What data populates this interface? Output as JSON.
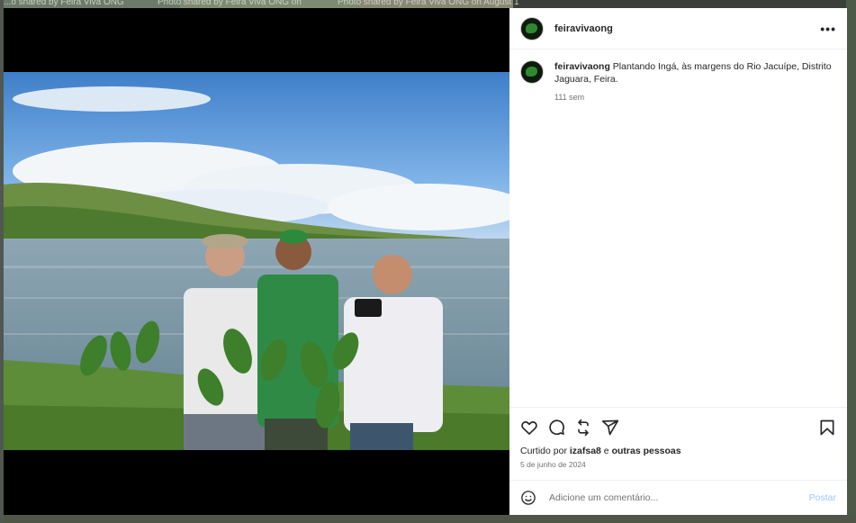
{
  "backdrop": {
    "snippet_1": "...o shared by Feira Viva ONG",
    "snippet_2": "Photo shared by Feira Viva ONG on",
    "snippet_3": "Photo shared by Feira Viva ONG on August 1"
  },
  "post": {
    "username": "feiravivaong",
    "more_label": "•••",
    "caption_user": "feiravivaong",
    "caption_text": " Plantando Ingá, às margens do Rio Jacuípe, Distrito Jaguara, Feira.",
    "time_ago": "111 sem",
    "likes_prefix": "Curtido por ",
    "likes_user": "izafsa8",
    "likes_suffix": " e ",
    "likes_others": "outras pessoas",
    "date": "5 de junho de 2024"
  },
  "comment": {
    "placeholder": "Adicione um comentário...",
    "post_label": "Postar"
  },
  "icons": {
    "like": "heart-icon",
    "comment": "comment-icon",
    "repost": "repost-icon",
    "share": "share-icon",
    "save": "bookmark-icon",
    "emoji": "emoji-icon"
  },
  "colors": {
    "post_button": "#9ac7f7",
    "meta_text": "#737373",
    "text": "#262626"
  }
}
